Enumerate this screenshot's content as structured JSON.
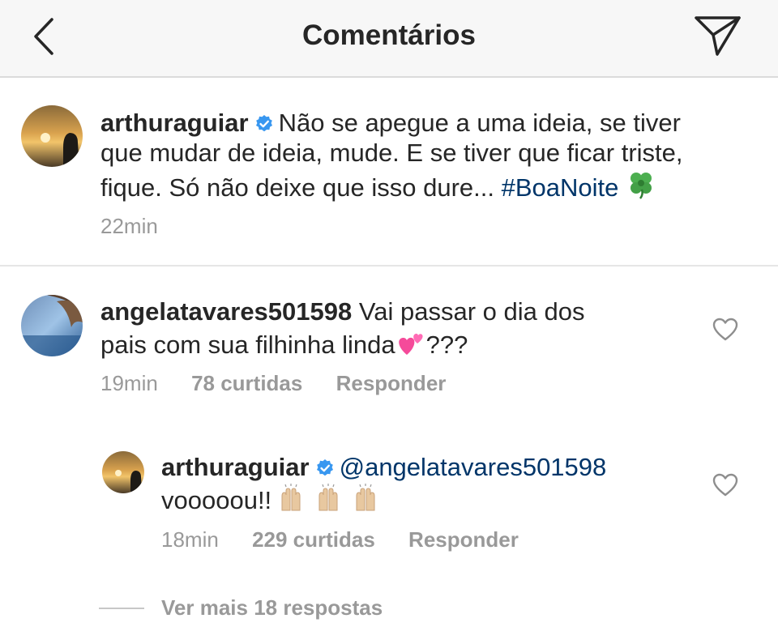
{
  "header": {
    "title": "Comentários",
    "back_icon": "chevron-left-icon",
    "send_icon": "paper-plane-icon"
  },
  "caption": {
    "username": "arthuraguiar",
    "line1": "Não se apegue a uma ideia, se tiver",
    "line2": "que mudar de ideia, mude. E se tiver que ficar triste,",
    "line3": "fique. Só não deixe que isso dure...",
    "hashtag": "#BoaNoite",
    "emoji": "four-leaf-clover",
    "time": "22min"
  },
  "comments": [
    {
      "username": "angelatavares501598",
      "line1": "Vai passar o dia dos",
      "line2": "pais com sua filhinha linda",
      "emoji": "two-hearts",
      "line2_suffix": "???",
      "time": "19min",
      "likes": "78 curtidas",
      "reply_label": "Responder"
    },
    {
      "username": "arthuraguiar",
      "mention": "@angelatavares501598",
      "line2": "vooooou!!",
      "emoji": "raising-hands x3",
      "time": "18min",
      "likes": "229 curtidas",
      "reply_label": "Responder"
    }
  ],
  "view_more": "Ver mais 18 respostas",
  "colors": {
    "header_bg": "#f7f7f7",
    "text": "#262626",
    "meta": "#999999",
    "hashtag": "#003569",
    "verified": "#3897f0"
  }
}
